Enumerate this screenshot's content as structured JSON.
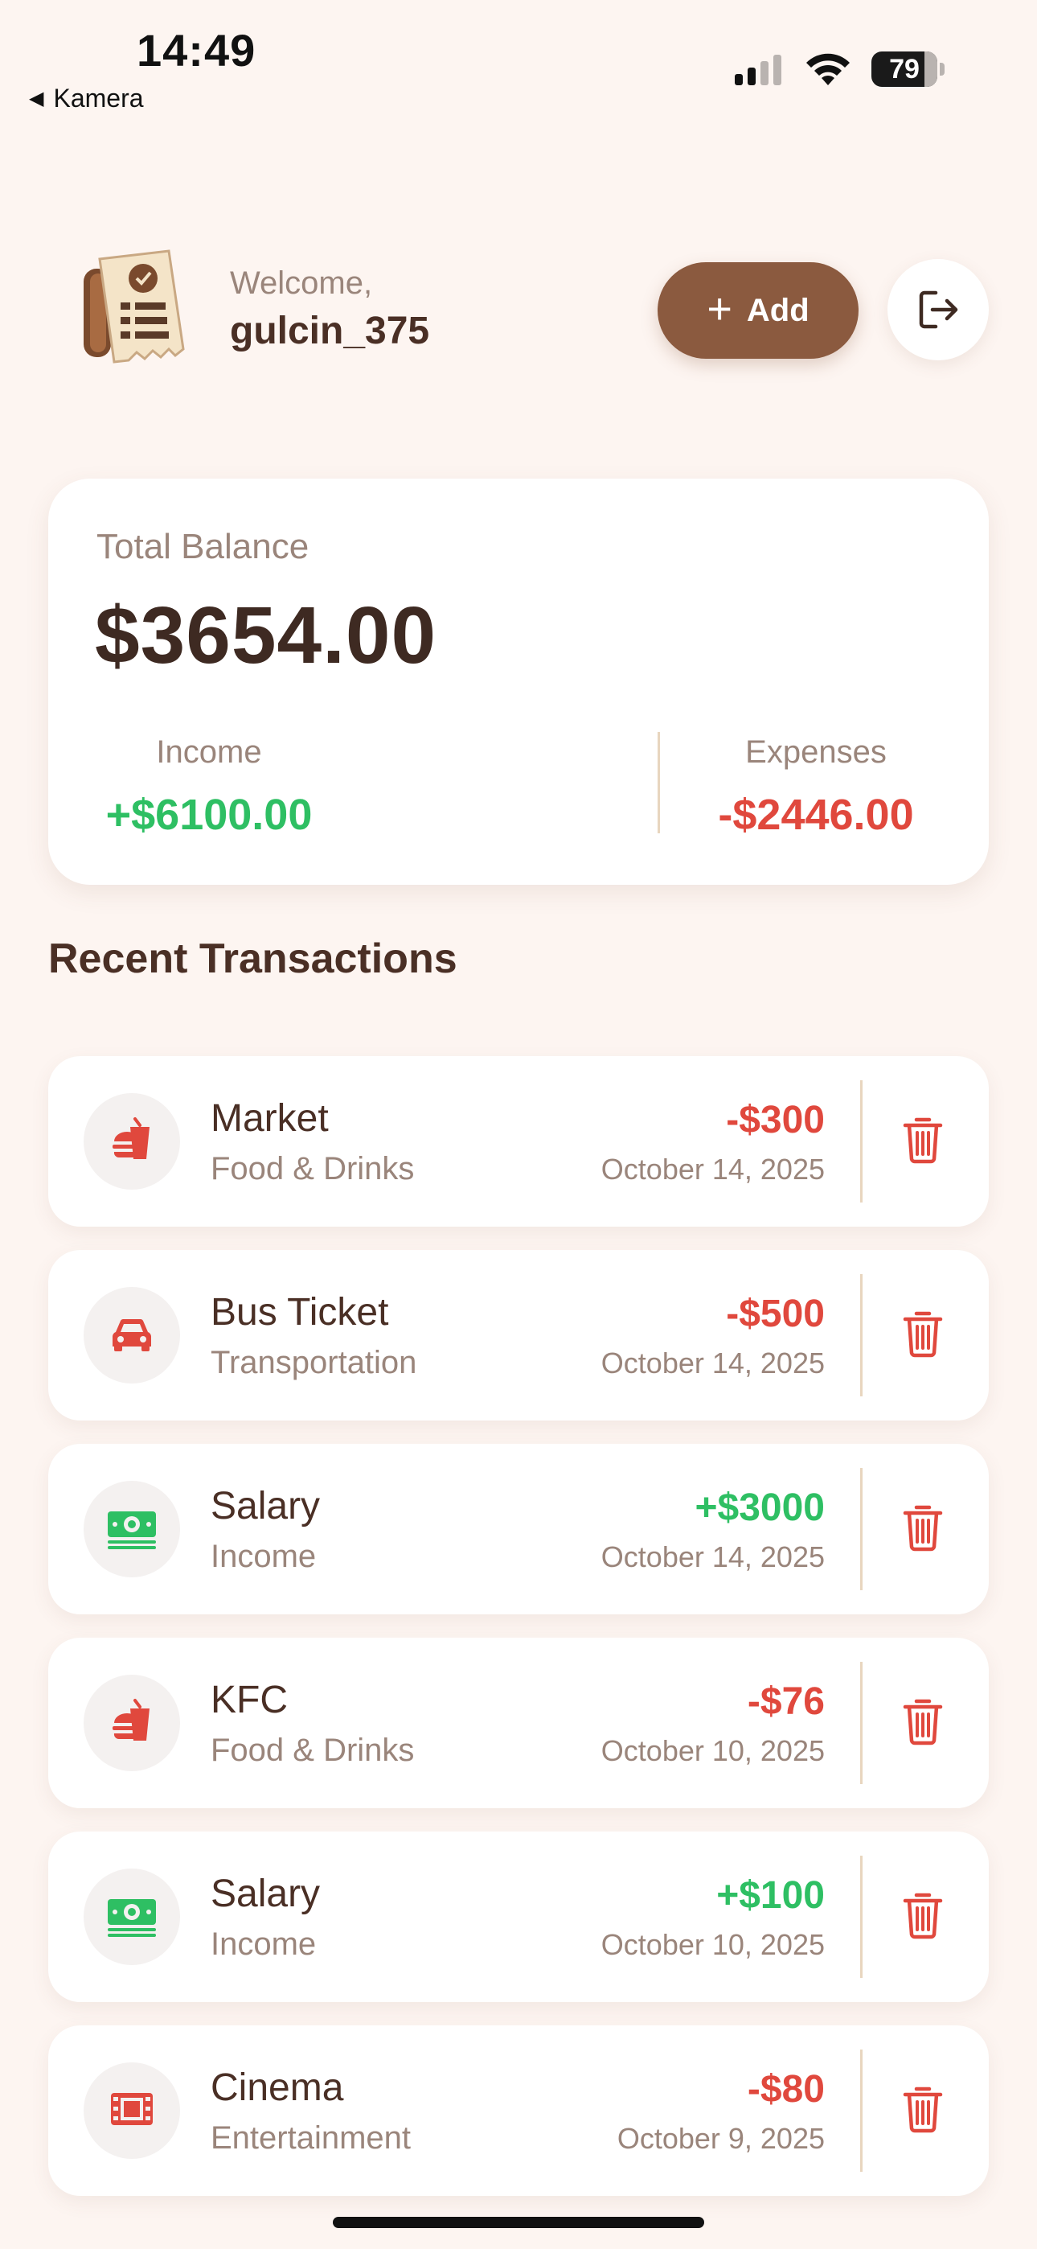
{
  "status_bar": {
    "time": "14:49",
    "back_app": "Kamera",
    "battery": "79"
  },
  "header": {
    "welcome_label": "Welcome,",
    "username": "gulcin_375",
    "add_label": "Add"
  },
  "balance": {
    "total_label": "Total Balance",
    "total_value": "$3654.00",
    "income_label": "Income",
    "income_value": "+$6100.00",
    "expenses_label": "Expenses",
    "expenses_value": "-$2446.00"
  },
  "section_title": "Recent Transactions",
  "transactions": [
    {
      "title": "Market",
      "category": "Food & Drinks",
      "amount": "-$300",
      "date": "October 14, 2025",
      "type": "expense",
      "icon": "food-icon"
    },
    {
      "title": "Bus Ticket",
      "category": "Transportation",
      "amount": "-$500",
      "date": "October 14, 2025",
      "type": "expense",
      "icon": "car-icon"
    },
    {
      "title": "Salary",
      "category": "Income",
      "amount": "+$3000",
      "date": "October 14, 2025",
      "type": "income",
      "icon": "money-icon"
    },
    {
      "title": "KFC",
      "category": "Food & Drinks",
      "amount": "-$76",
      "date": "October 10, 2025",
      "type": "expense",
      "icon": "food-icon"
    },
    {
      "title": "Salary",
      "category": "Income",
      "amount": "+$100",
      "date": "October 10, 2025",
      "type": "income",
      "icon": "money-icon"
    },
    {
      "title": "Cinema",
      "category": "Entertainment",
      "amount": "-$80",
      "date": "October 9, 2025",
      "type": "expense",
      "icon": "film-icon"
    }
  ],
  "colors": {
    "income": "#2ebf63",
    "expense": "#e0483d",
    "accent": "#8b5a3f",
    "background": "#fdf5f1"
  }
}
